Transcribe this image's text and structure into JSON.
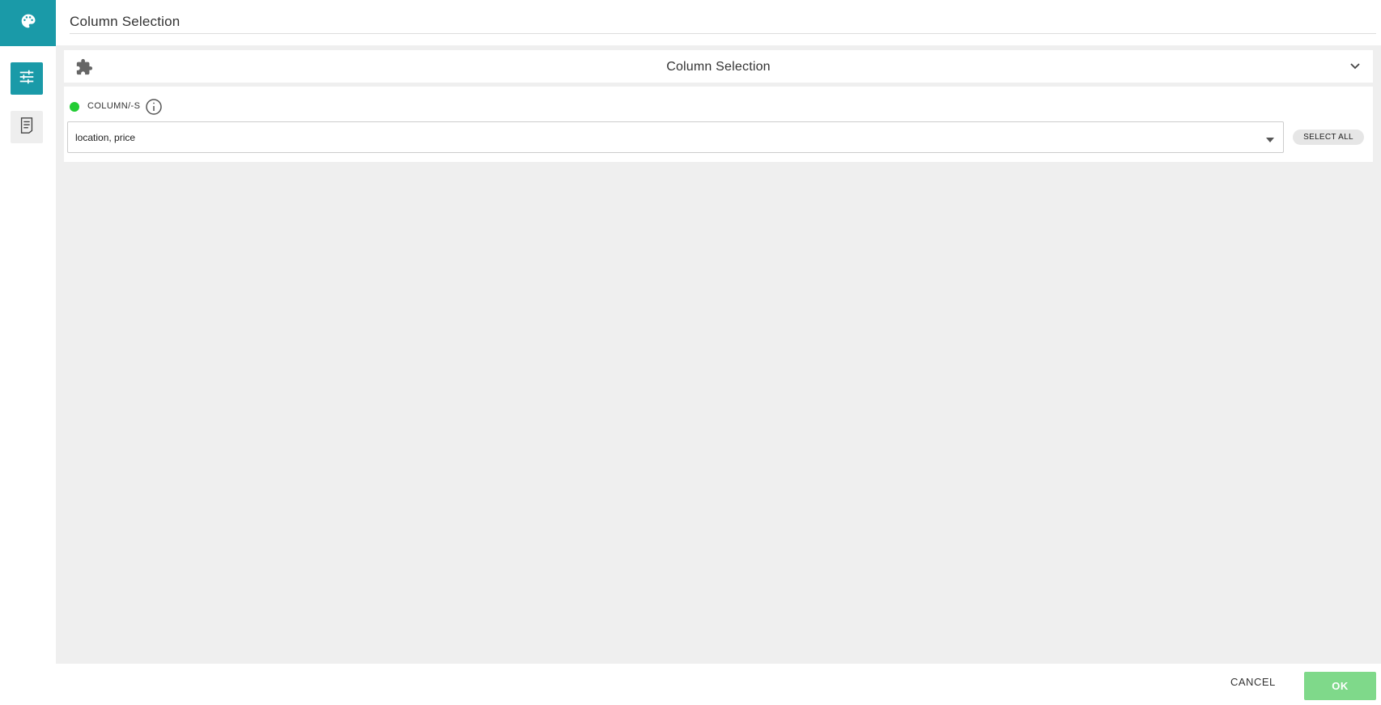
{
  "header": {
    "title": "Column Selection"
  },
  "sidebar": {
    "top_icon": "palette-icon",
    "items": [
      {
        "icon": "sliders-icon",
        "active": true
      },
      {
        "icon": "document-icon",
        "active": false
      }
    ]
  },
  "section": {
    "icon": "puzzle-icon",
    "title": "Column Selection",
    "toggle_icon": "chevron-down-icon"
  },
  "field": {
    "status_color": "#22cc33",
    "label": "COLUMN/-S",
    "info_icon": "info-icon",
    "value": "location, price",
    "select_all_label": "SELECT ALL"
  },
  "footer": {
    "cancel_label": "CANCEL",
    "ok_label": "OK"
  },
  "colors": {
    "accent": "#1a9aa8",
    "ok_button": "#7fd98a",
    "background": "#efefef"
  }
}
